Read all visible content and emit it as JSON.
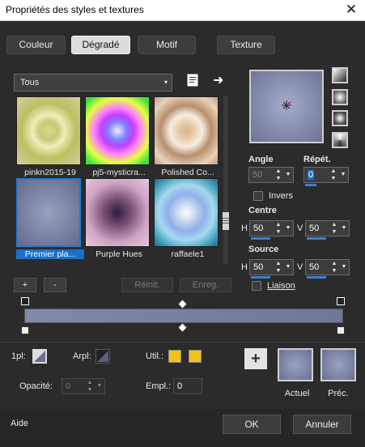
{
  "window": {
    "title": "Propriétés des styles et textures",
    "close": "✕"
  },
  "tabs": [
    {
      "label": "Couleur",
      "active": false
    },
    {
      "label": "Dégradé",
      "active": true
    },
    {
      "label": "Motif",
      "active": false
    },
    {
      "label": "Texture",
      "active": false
    }
  ],
  "category": {
    "selected": "Tous",
    "caret": "▾"
  },
  "icons": {
    "doc": "document-icon",
    "arrow": "➜"
  },
  "swatches": [
    {
      "label": "pinkn2015-19",
      "selected": false
    },
    {
      "label": "pj5-mysticra...",
      "selected": false
    },
    {
      "label": "Polished Co...",
      "selected": false
    },
    {
      "label": "Premier pla...",
      "selected": true
    },
    {
      "label": "Purple Hues",
      "selected": false
    },
    {
      "label": "raffaele1",
      "selected": false
    }
  ],
  "gallery_buttons": {
    "add": "+",
    "remove": "-",
    "reset": "Réinit.",
    "save": "Enreg."
  },
  "angle": {
    "label": "Angle",
    "value": "50"
  },
  "repeat": {
    "label": "Répét.",
    "value": "0"
  },
  "invert": {
    "label": "Invers",
    "checked": false
  },
  "centre": {
    "label": "Centre",
    "h_label": "H",
    "h": "50",
    "v_label": "V",
    "v": "50"
  },
  "source": {
    "label": "Source",
    "h_label": "H",
    "h": "50",
    "v_label": "V",
    "v": "50"
  },
  "link": {
    "label": "Liaison",
    "checked": false
  },
  "bottom": {
    "first_plane": "1pl:",
    "back_plane": "Arpl:",
    "used": "Util.:",
    "opacity_label": "Opacité:",
    "opacity_value": "0",
    "empl_label": "Empl.:",
    "empl_value": "0",
    "current": "Actuel",
    "previous": "Préc."
  },
  "footer": {
    "help": "Aide",
    "ok": "OK",
    "cancel": "Annuler"
  },
  "colors": {
    "accent": "#1e6fc4",
    "swatch_yellow": "#f2c21b",
    "gradient_start": "#8288a7",
    "gradient_end": "#6f7699"
  }
}
